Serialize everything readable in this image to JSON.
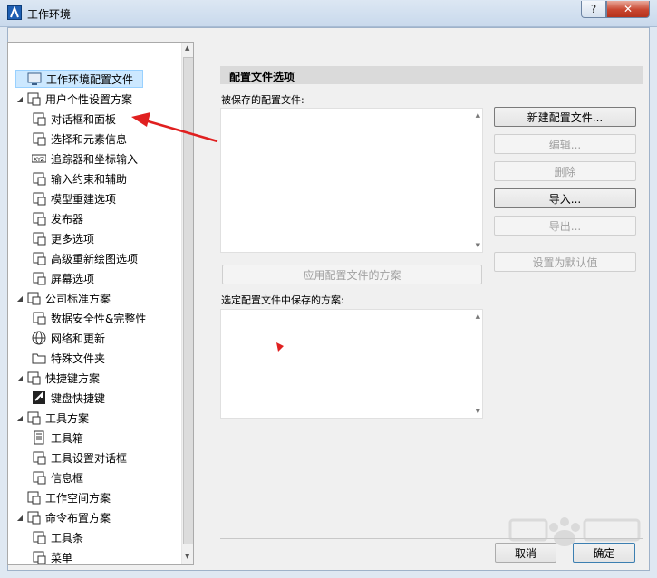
{
  "window": {
    "title": "工作环境",
    "help_label": "?",
    "close_label": "✕"
  },
  "tree": {
    "items": [
      {
        "label": "工作环境配置文件",
        "level": 0,
        "expander": "",
        "icon": "profile-monitor-icon",
        "selected": true
      },
      {
        "label": "用户个性设置方案",
        "level": 0,
        "expander": "◢",
        "icon": "user-scheme-icon"
      },
      {
        "label": "对话框和面板",
        "level": 1,
        "expander": "",
        "icon": "dialog-panel-icon"
      },
      {
        "label": "选择和元素信息",
        "level": 1,
        "expander": "",
        "icon": "selection-info-icon"
      },
      {
        "label": "追踪器和坐标输入",
        "level": 1,
        "expander": "",
        "icon": "xyz-tracker-icon"
      },
      {
        "label": "输入约束和辅助",
        "level": 1,
        "expander": "",
        "icon": "mouse-input-icon"
      },
      {
        "label": "模型重建选项",
        "level": 1,
        "expander": "",
        "icon": "model-rebuild-icon"
      },
      {
        "label": "发布器",
        "level": 1,
        "expander": "",
        "icon": "publisher-icon"
      },
      {
        "label": "更多选项",
        "level": 1,
        "expander": "",
        "icon": "more-options-icon"
      },
      {
        "label": "高级重新绘图选项",
        "level": 1,
        "expander": "",
        "icon": "redraw-icon"
      },
      {
        "label": "屏幕选项",
        "level": 1,
        "expander": "",
        "icon": "screen-icon"
      },
      {
        "label": "公司标准方案",
        "level": 0,
        "expander": "◢",
        "icon": "company-scheme-icon"
      },
      {
        "label": "数据安全性&完整性",
        "level": 1,
        "expander": "",
        "icon": "data-safety-icon"
      },
      {
        "label": "网络和更新",
        "level": 1,
        "expander": "",
        "icon": "globe-icon"
      },
      {
        "label": "特殊文件夹",
        "level": 1,
        "expander": "",
        "icon": "folder-icon"
      },
      {
        "label": "快捷键方案",
        "level": 0,
        "expander": "◢",
        "icon": "shortcut-scheme-icon"
      },
      {
        "label": "键盘快捷键",
        "level": 1,
        "expander": "",
        "icon": "keyboard-icon"
      },
      {
        "label": "工具方案",
        "level": 0,
        "expander": "◢",
        "icon": "tool-scheme-icon"
      },
      {
        "label": "工具箱",
        "level": 1,
        "expander": "",
        "icon": "toolbox-icon"
      },
      {
        "label": "工具设置对话框",
        "level": 1,
        "expander": "",
        "icon": "tool-settings-icon"
      },
      {
        "label": "信息框",
        "level": 1,
        "expander": "",
        "icon": "info-box-icon"
      },
      {
        "label": "工作空间方案",
        "level": 0,
        "expander": "",
        "icon": "workspace-scheme-icon"
      },
      {
        "label": "命令布置方案",
        "level": 0,
        "expander": "◢",
        "icon": "command-scheme-icon"
      },
      {
        "label": "工具条",
        "level": 1,
        "expander": "",
        "icon": "toolbar-icon"
      },
      {
        "label": "菜单",
        "level": 1,
        "expander": "",
        "icon": "menu-icon"
      }
    ]
  },
  "panel": {
    "header": "配置文件选项",
    "saved_profiles_label": "被保存的配置文件:",
    "schemes_label": "选定配置文件中保存的方案:",
    "apply_button": "应用配置文件的方案",
    "buttons": {
      "new": "新建配置文件...",
      "edit": "编辑...",
      "delete": "删除",
      "import": "导入...",
      "export": "导出...",
      "set_default": "设置为默认值"
    }
  },
  "footer": {
    "cancel": "取消",
    "ok": "确定"
  }
}
